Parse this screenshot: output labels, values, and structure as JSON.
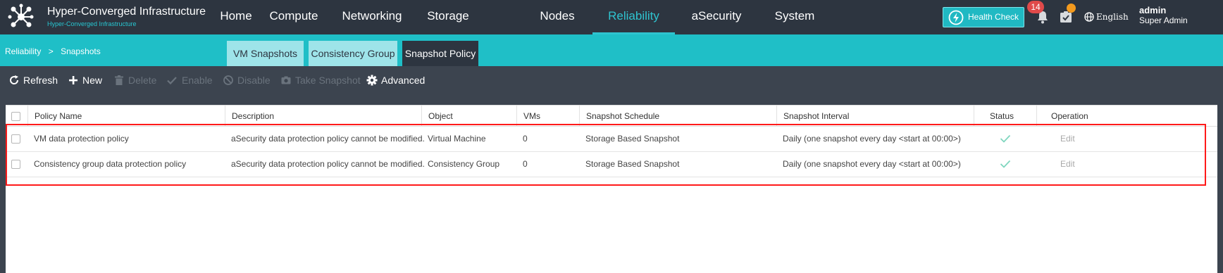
{
  "app": {
    "title": "Hyper-Converged Infrastructure",
    "subtitle": "Hyper-Converged Infrastructure",
    "logo_icon": "molecule-logo-icon"
  },
  "nav": {
    "items": [
      "Home",
      "Compute",
      "Networking",
      "Storage",
      "Nodes",
      "Reliability",
      "aSecurity",
      "System"
    ],
    "active": "Reliability",
    "accent_color": "#2ec4d0"
  },
  "header": {
    "health_check_label": "Health Check",
    "notification_count": "14",
    "language": "English",
    "user": {
      "name": "admin",
      "role": "Super Admin"
    },
    "icons": [
      "heartbeat-icon",
      "bell-icon",
      "task-icon",
      "globe-icon"
    ]
  },
  "breadcrumb": {
    "items": [
      "Reliability",
      "Snapshots"
    ],
    "separator": ">"
  },
  "tabs": {
    "items": [
      "VM Snapshots",
      "Consistency Group",
      "Snapshot Policy"
    ],
    "active": "Snapshot Policy"
  },
  "toolbar": {
    "refresh": "Refresh",
    "new": "New",
    "delete": "Delete",
    "enable": "Enable",
    "disable": "Disable",
    "take_snapshot": "Take Snapshot",
    "advanced": "Advanced",
    "disabled_actions": [
      "Delete",
      "Enable",
      "Disable",
      "Take Snapshot"
    ]
  },
  "table": {
    "columns": [
      "Policy Name",
      "Description",
      "Object",
      "VMs",
      "Snapshot Schedule",
      "Snapshot Interval",
      "Status",
      "Operation"
    ],
    "rows": [
      {
        "policy_name": "VM data protection policy",
        "description": "aSecurity data protection policy cannot be modified.",
        "object": "Virtual Machine",
        "vms": "0",
        "schedule": "Storage Based Snapshot",
        "interval": "Daily (one snapshot every day <start at 00:00>)",
        "status_icon": "checkmark-icon",
        "operation": "Edit"
      },
      {
        "policy_name": "Consistency group data protection policy",
        "description": "aSecurity data protection policy cannot be modified.",
        "object": "Consistency Group",
        "vms": "0",
        "schedule": "Storage Based Snapshot",
        "interval": "Daily (one snapshot every day <start at 00:00>)",
        "status_icon": "checkmark-icon",
        "operation": "Edit"
      }
    ]
  },
  "colors": {
    "topbar": "#2d3540",
    "subbar": "#1fbfc7",
    "toolbar": "#3c444f",
    "highlight": "#ff1a1a",
    "status_ok": "#7fd6bf",
    "badge": "#e04a4a"
  }
}
